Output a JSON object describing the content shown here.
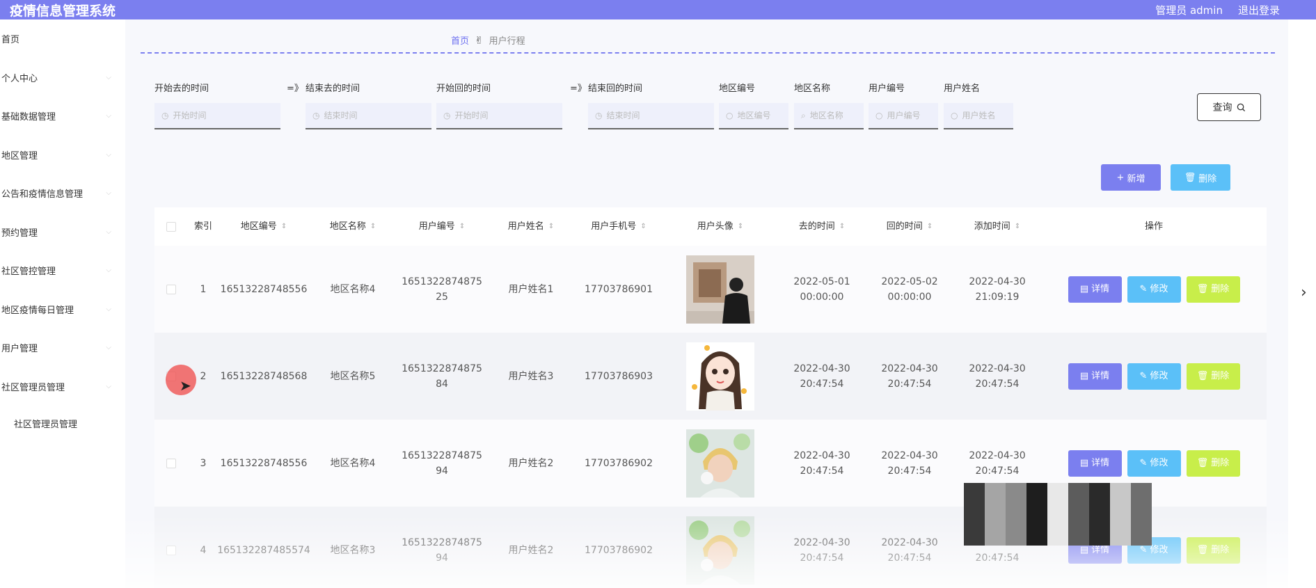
{
  "header": {
    "app_title": "疫情信息管理系统",
    "user": "管理员 admin",
    "logout": "退出登录"
  },
  "sidebar": {
    "items": [
      {
        "label": "首页",
        "has_chevron": false
      },
      {
        "label": "个人中心",
        "has_chevron": true
      },
      {
        "label": "基础数据管理",
        "has_chevron": true
      },
      {
        "label": "地区管理",
        "has_chevron": true
      },
      {
        "label": "公告和疫情信息管理",
        "has_chevron": true
      },
      {
        "label": "预约管理",
        "has_chevron": true
      },
      {
        "label": "社区管控管理",
        "has_chevron": true
      },
      {
        "label": "地区疫情每日管理",
        "has_chevron": true
      },
      {
        "label": "用户管理",
        "has_chevron": true
      },
      {
        "label": "社区管理员管理",
        "has_chevron": true
      }
    ],
    "subitem": "社区管理员管理"
  },
  "breadcrumb": {
    "home": "首页",
    "current": "用户行程"
  },
  "search": {
    "range_separator": "=》",
    "fields": [
      {
        "label": "开始去的时间",
        "placeholder": "开始时间",
        "icon": "clock-icon"
      },
      {
        "label": "结束去的时间",
        "placeholder": "结束时间",
        "icon": "clock-icon"
      },
      {
        "label": "开始回的时间",
        "placeholder": "开始时间",
        "icon": "clock-icon"
      },
      {
        "label": "结束回的时间",
        "placeholder": "结束时间",
        "icon": "clock-icon"
      },
      {
        "label": "地区编号",
        "placeholder": "地区编号",
        "icon": "circle-icon"
      },
      {
        "label": "地区名称",
        "placeholder": "地区名称",
        "icon": "search-icon"
      },
      {
        "label": "用户编号",
        "placeholder": "用户编号",
        "icon": "circle-icon"
      },
      {
        "label": "用户姓名",
        "placeholder": "用户姓名",
        "icon": "circle-icon"
      }
    ],
    "query_label": "查询"
  },
  "actions": {
    "add_label": "新增",
    "delete_label": "删除"
  },
  "table": {
    "headers": [
      "索引",
      "地区编号",
      "地区名称",
      "用户编号",
      "用户姓名",
      "用户手机号",
      "用户头像",
      "去的时间",
      "回的时间",
      "添加时间",
      "操作"
    ],
    "rows": [
      {
        "index": "1",
        "area_code": "16513228748556",
        "area_name": "地区名称4",
        "user_code": "1651322874875 25",
        "user_name": "用户姓名1",
        "phone": "17703786901",
        "go_time": "2022-05-01 00:00:00",
        "back_time": "2022-05-02 00:00:00",
        "add_time": "2022-04-30 21:09:19",
        "avatar": "photo-man"
      },
      {
        "index": "2",
        "area_code": "16513228748568",
        "area_name": "地区名称5",
        "user_code": "1651322874875 84",
        "user_name": "用户姓名3",
        "phone": "17703786903",
        "go_time": "2022-04-30 20:47:54",
        "back_time": "2022-04-30 20:47:54",
        "add_time": "2022-04-30 20:47:54",
        "avatar": "cartoon-girl"
      },
      {
        "index": "3",
        "area_code": "16513228748556",
        "area_name": "地区名称4",
        "user_code": "1651322874875 94",
        "user_name": "用户姓名2",
        "phone": "17703786902",
        "go_time": "2022-04-30 20:47:54",
        "back_time": "2022-04-30 20:47:54",
        "add_time": "2022-04-30 20:47:54",
        "avatar": "photo-boy"
      },
      {
        "index": "4",
        "area_code": "165132287485574",
        "area_name": "地区名称3",
        "user_code": "1651322874875 94",
        "user_name": "用户姓名2",
        "phone": "17703786902",
        "go_time": "2022-04-30 20:47:54",
        "back_time": "2022-04-30 20:47:54",
        "add_time": "2022-04-30 20:47:54",
        "avatar": "photo-boy"
      }
    ],
    "op_labels": {
      "detail": "详情",
      "edit": "修改",
      "delete": "删除"
    }
  },
  "colors": {
    "accent": "#7b7fef",
    "cyan": "#5bc0f8",
    "lime": "#c8ee4a"
  }
}
